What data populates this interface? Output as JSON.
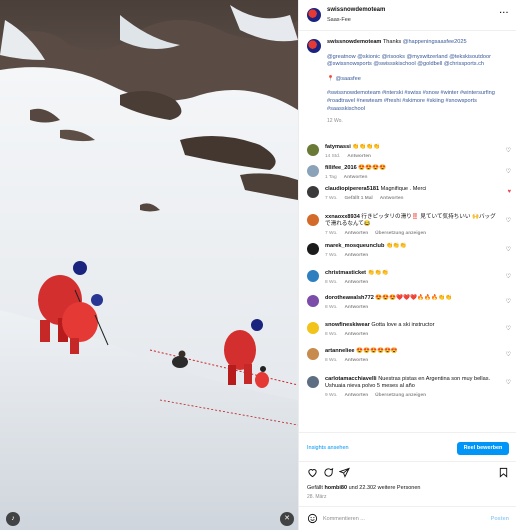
{
  "post": {
    "username": "swissnowdemoteam",
    "location": "Saas-Fee",
    "more_icon": "more-horizontal-icon"
  },
  "caption": {
    "username": "swissnowdemoteam",
    "thanks": "Thanks",
    "thanks_mention": "@happeningsaasfee2025",
    "mentions": "@greatnow @skionic @risooks @myswitzerland @tekskisoutdoor @swissnowsports @swissskischool @goldbell @chrissports.ch",
    "location_tag": "@saasfee",
    "hashtags": "#swissnowdemoteam #interski #swiss #snow #winter #wintersurfing #roadtravel #newteam #freshi #skimore #skiing #snowsports #saasskischool",
    "age": "12 Wo."
  },
  "comments": [
    {
      "username": "fatymassi",
      "text": "👏👏👏👏",
      "meta": [
        "14 Std.",
        "Antworten"
      ],
      "liked": false,
      "avatar": "#6b7a36"
    },
    {
      "username": "fillifee_2016",
      "text": "😍😍😍😍",
      "meta": [
        "1 Tag",
        "Antworten"
      ],
      "liked": false,
      "avatar": "#8aa3b8"
    },
    {
      "username": "claudiopiperera5181",
      "text": "Magnifique . Merci",
      "meta": [
        "7 Wo.",
        "Gefällt 1 Mal",
        "Antworten"
      ],
      "liked": true,
      "avatar": "#3a3a3a"
    },
    {
      "username": "xxnaoxx8934",
      "text": "行きピッタリの滑り‼️ 見ていて気持ちいい 🙌バッグで滑れるなんて😂",
      "meta": [
        "7 Wo.",
        "Antworten",
        "Übersetzung anzeigen"
      ],
      "liked": false,
      "avatar": "#d36a2a"
    },
    {
      "username": "marek_mosqueunclub",
      "text": "👏👏👏",
      "meta": [
        "7 Wo.",
        "Antworten"
      ],
      "liked": false,
      "avatar": "#1b1b1b"
    },
    {
      "username": "christmasticket",
      "text": "👏👏👏",
      "meta": [
        "8 Wo.",
        "Antworten"
      ],
      "liked": false,
      "avatar": "#2e7fc0"
    },
    {
      "username": "dorotheawalsh772",
      "text": "😍😍😍❤️❤️❤️🔥🔥🔥👏👏",
      "meta": [
        "8 Wo.",
        "Antworten"
      ],
      "liked": false,
      "avatar": "#7b4ca8"
    },
    {
      "username": "snowfineskiwear",
      "text": "Gotta love a ski instructor",
      "meta": [
        "8 Wo.",
        "Antworten"
      ],
      "liked": false,
      "avatar": "#f2c318"
    },
    {
      "username": "artanneliee",
      "text": "😍😍😍😍😍😍",
      "meta": [
        "8 Wo.",
        "Antworten"
      ],
      "liked": false,
      "avatar": "#c68b4d"
    },
    {
      "username": "carlotamacchiavelli",
      "text": "Nuestras pistas en Argentina son muy bellas. Ushuaia nieva polvo 5 meses al año",
      "meta": [
        "9 Wo.",
        "Antworten",
        "Übersetzung anzeigen"
      ],
      "liked": false,
      "avatar": "#5d6e82"
    }
  ],
  "insights": {
    "link": "Insights ansehen",
    "button": "Reel bewerben"
  },
  "actions": {
    "icons": [
      "heart-icon",
      "comment-icon",
      "share-icon",
      "save-icon"
    ],
    "liked_by_prefix": "Gefällt",
    "liked_by_user": "hombi80",
    "liked_by_suffix": "und 22.302 weitere Personen",
    "date": "28. März"
  },
  "comment_box": {
    "placeholder": "Kommentieren ...",
    "post_label": "Posten"
  }
}
